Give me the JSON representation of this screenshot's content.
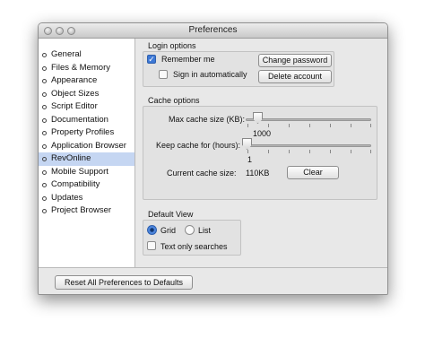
{
  "window": {
    "title": "Preferences"
  },
  "sidebar": {
    "items": [
      {
        "label": "General"
      },
      {
        "label": "Files & Memory"
      },
      {
        "label": "Appearance"
      },
      {
        "label": "Object Sizes"
      },
      {
        "label": "Script Editor"
      },
      {
        "label": "Documentation"
      },
      {
        "label": "Property Profiles"
      },
      {
        "label": "Application Browser"
      },
      {
        "label": "RevOnline"
      },
      {
        "label": "Mobile Support"
      },
      {
        "label": "Compatibility"
      },
      {
        "label": "Updates"
      },
      {
        "label": "Project Browser"
      }
    ],
    "selected": "RevOnline"
  },
  "login": {
    "heading": "Login options",
    "remember_me": "Remember me",
    "remember_me_checked": true,
    "auto_signin": "Sign in automatically",
    "auto_signin_checked": false,
    "change_password": "Change password",
    "delete_account": "Delete account"
  },
  "cache": {
    "heading": "Cache options",
    "max_size_label": "Max cache size (KB):",
    "max_size_value": "1000",
    "keep_for_label": "Keep cache for (hours):",
    "keep_for_value": "1",
    "current_size_label": "Current cache size:",
    "current_size_value": "110KB",
    "clear_label": "Clear"
  },
  "view": {
    "heading": "Default View",
    "grid": "Grid",
    "list": "List",
    "selected": "Grid",
    "text_only": "Text only searches",
    "text_only_checked": false
  },
  "footer": {
    "reset_label": "Reset All Preferences to Defaults"
  },
  "colors": {
    "selection": "#c5d6f2",
    "accent": "#3e79d6"
  }
}
